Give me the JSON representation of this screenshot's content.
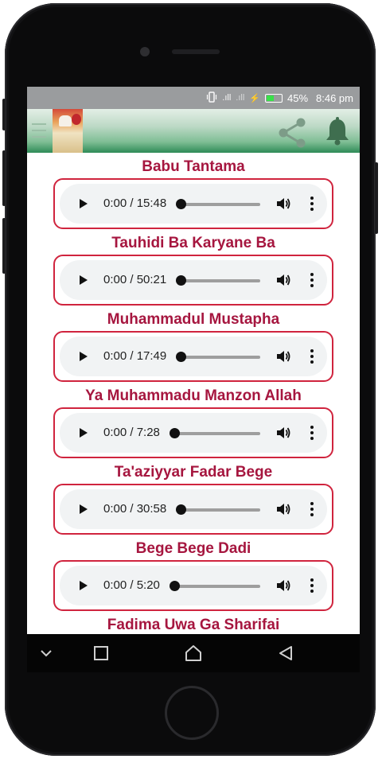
{
  "status_bar": {
    "signal_left": ".ıll",
    "signal_right": ".ıll",
    "charging": "⚡",
    "battery_percent": "45%",
    "battery_level": 0.45,
    "time": "8:46 pm"
  },
  "app_bar": {
    "menu_icon": "hamburger-icon",
    "share_icon": "share-icon",
    "notification_icon": "bell-icon"
  },
  "tracks": [
    {
      "title": "Babu Tantama",
      "time": "0:00 / 15:48"
    },
    {
      "title": "Tauhidi Ba Karyane Ba",
      "time": "0:00 / 50:21"
    },
    {
      "title": "Muhammadul Mustapha",
      "time": "0:00 / 17:49"
    },
    {
      "title": "Ya Muhammadu Manzon Allah",
      "time": "0:00 / 7:28"
    },
    {
      "title": "Ta'aziyyar Fadar Bege",
      "time": "0:00 / 30:58"
    },
    {
      "title": "Bege Bege Dadi",
      "time": "0:00 / 5:20"
    },
    {
      "title": "Fadima Uwa Ga Sharifai",
      "time": ""
    }
  ],
  "nav_bar": {
    "back_icon": "chevron-down-icon",
    "recents_icon": "square-icon",
    "home_icon": "home-icon",
    "back_triangle_icon": "back-triangle-icon"
  },
  "colors": {
    "title_color": "#a6163f",
    "frame_border": "#d0243e",
    "appbar_green": "#2e8b57",
    "statusbar_gray": "#9a9c9e"
  }
}
